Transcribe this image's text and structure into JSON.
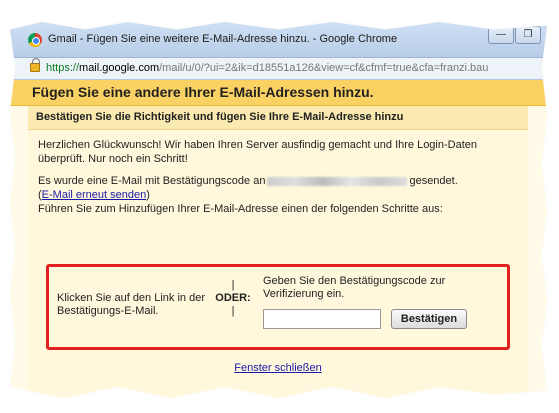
{
  "browser": {
    "window_title": "Gmail - Fügen Sie eine weitere E-Mail-Adresse hinzu. - Google Chrome",
    "buttons": {
      "minimize": "—",
      "restore": "❐",
      "close": "✕"
    },
    "url_scheme": "https://",
    "url_host": "mail.google.com",
    "url_path": "/mail/u/0/?ui=2&ik=d18551a126&view=cf&cfmf=true&cfa=franzi.bau"
  },
  "page": {
    "header": "Fügen Sie eine andere Ihrer E-Mail-Adressen hinzu.",
    "subheader": "Bestätigen Sie die Richtigkeit und fügen Sie Ihre E-Mail-Adresse hinzu",
    "congrats": "Herzlichen Glückwunsch! Wir haben Ihren Server ausfindig gemacht und Ihre Login-Daten überprüft. Nur noch ein Schritt!",
    "sent_prefix": "Es wurde eine E-Mail mit Bestätigungscode an",
    "sent_suffix": "gesendet.",
    "resend_open": "(",
    "resend_link": "E-Mail erneut senden",
    "resend_close": ")",
    "instructions": "Führen Sie zum Hinzufügen Ihrer E-Mail-Adresse einen der folgenden Schritte aus:",
    "option_link": "Klicken Sie auf den Link in der Bestätigungs-E-Mail.",
    "separator_bar": "|",
    "or_label": "ODER:",
    "option_code": "Geben Sie den Bestätigungscode zur Verifizierung ein.",
    "code_value": "",
    "confirm_button": "Bestätigen",
    "close_link": "Fenster schließen"
  },
  "colors": {
    "header_band": "#fad163",
    "highlight_border": "#e12020",
    "link": "#1a1aa6"
  }
}
